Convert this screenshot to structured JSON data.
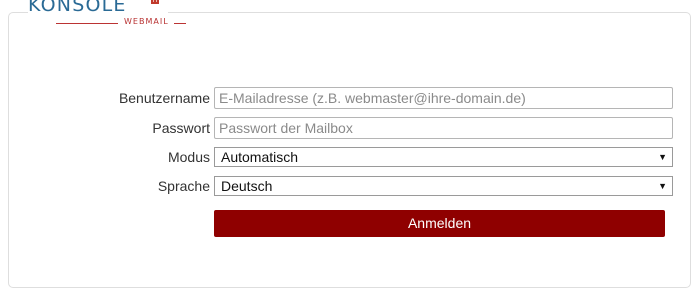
{
  "logo": {
    "brand": "KONSOLE",
    "badge": "H",
    "sub": "WEBMAIL"
  },
  "form": {
    "username_label": "Benutzername",
    "username_placeholder": "E-Mailadresse (z.B. webmaster@ihre-domain.de)",
    "password_label": "Passwort",
    "password_placeholder": "Passwort der Mailbox",
    "mode_label": "Modus",
    "mode_value": "Automatisch",
    "language_label": "Sprache",
    "language_value": "Deutsch",
    "submit_label": "Anmelden"
  },
  "colors": {
    "accent": "#8f0000",
    "logo_blue": "#2a6a95",
    "border": "#dedede"
  },
  "icons": {
    "dropdown": "chevron-down-icon"
  }
}
